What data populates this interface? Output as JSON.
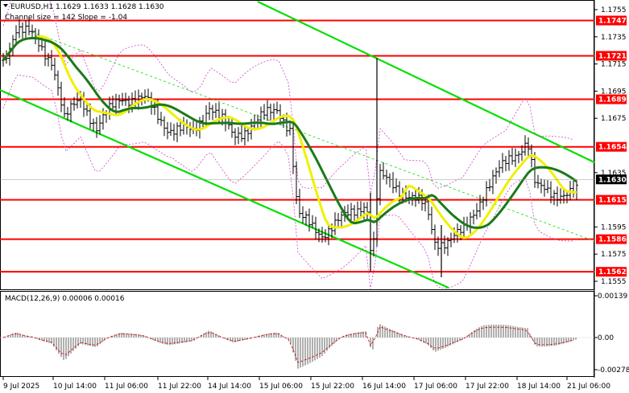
{
  "header": {
    "symbol_line": "EURUSD,H1  1.1629 1.1633 1.1628 1.1630",
    "channel_line": "Channel size = 142 Slope = -1.04"
  },
  "macd": {
    "label": "MACD(12,26,9) 0.00006 0.00016",
    "axis": [
      "0.00139",
      "0.00",
      "-0.00278"
    ]
  },
  "price_axis": [
    "1.1755",
    "1.1735",
    "1.1715",
    "1.1695",
    "1.1675",
    "1.1635",
    "1.1595",
    "1.1575",
    "1.1555"
  ],
  "levels": [
    {
      "value": 1.1747,
      "label": "1.1747"
    },
    {
      "value": 1.1721,
      "label": "1.1721"
    },
    {
      "value": 1.1689,
      "label": "1.1689"
    },
    {
      "value": 1.1654,
      "label": "1.1654"
    },
    {
      "value": 1.1615,
      "label": "1.1615"
    },
    {
      "value": 1.1586,
      "label": "1.1586"
    },
    {
      "value": 1.1562,
      "label": "1.1562"
    }
  ],
  "current_price": "1.1630",
  "time_axis": [
    "9 Jul 2025",
    "10 Jul 14:00",
    "11 Jul 06:00",
    "11 Jul 22:00",
    "14 Jul 14:00",
    "15 Jul 06:00",
    "15 Jul 22:00",
    "16 Jul 14:00",
    "17 Jul 06:00",
    "17 Jul 22:00",
    "18 Jul 14:00",
    "21 Jul 06:00"
  ],
  "colors": {
    "level": "#ff0000",
    "channel": "#00e000",
    "ma_fast": "#f0f000",
    "ma_slow": "#1a7a1a",
    "candles": "#000000",
    "bands": "#cc44cc",
    "macd_hist": "#b0b0b0",
    "macd_signal": "#cc0000"
  }
}
